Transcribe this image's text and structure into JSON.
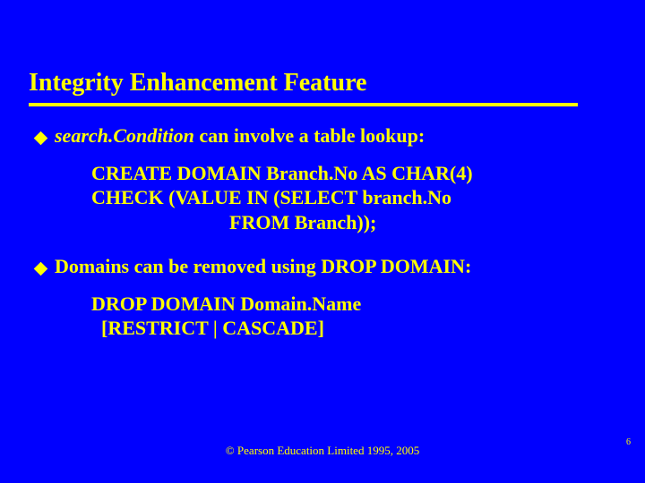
{
  "title": "Integrity Enhancement Feature",
  "bullet1": {
    "term": "search.Condition",
    "rest": " can involve a table lookup:"
  },
  "code": {
    "l1": "CREATE DOMAIN Branch.No AS CHAR(4)",
    "l2": "CHECK (VALUE IN (SELECT branch.No",
    "l3": "                            FROM Branch));"
  },
  "bullet2": {
    "term": "Domains",
    "rest": " can be removed using DROP DOMAIN:"
  },
  "syntax": {
    "l1": "DROP DOMAIN Domain.Name",
    "l2": "  [RESTRICT | CASCADE]"
  },
  "footer": "© Pearson Education Limited 1995, 2005",
  "slide_number": "6"
}
